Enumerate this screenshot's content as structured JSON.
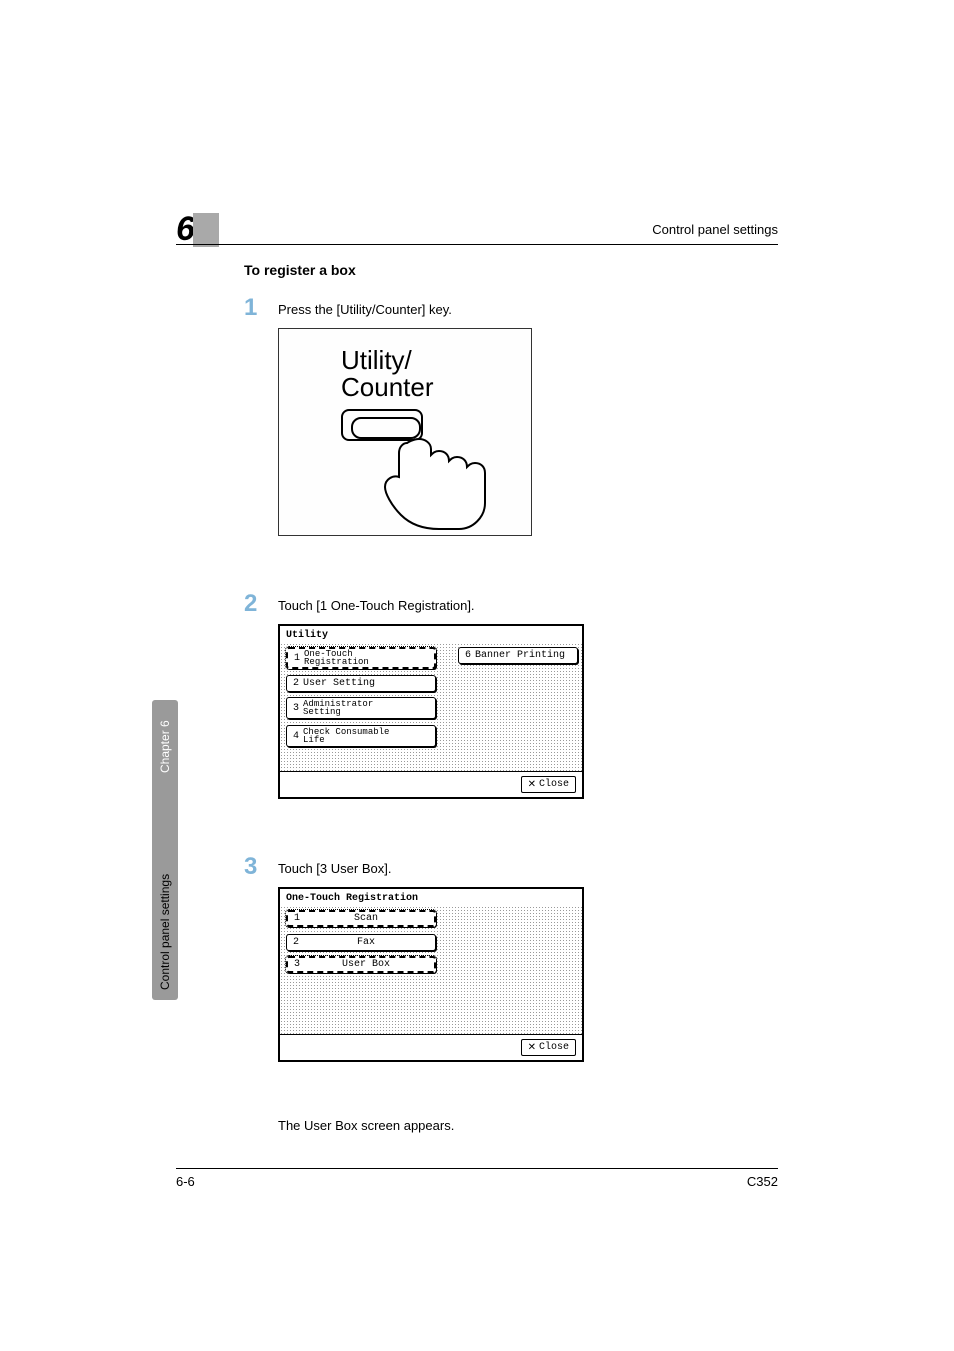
{
  "header": {
    "chapter_number": "6",
    "right_label": "Control panel settings"
  },
  "side_tab": {
    "section": "Control panel settings",
    "chapter": "Chapter 6"
  },
  "section": {
    "heading": "To register a box"
  },
  "steps": {
    "s1": {
      "num": "1",
      "text": "Press the [Utility/Counter] key."
    },
    "s2": {
      "num": "2",
      "text": "Touch [1 One-Touch Registration]."
    },
    "s3": {
      "num": "3",
      "text": "Touch [3 User Box]."
    }
  },
  "fig1": {
    "label_line1": "Utility/",
    "label_line2": "Counter"
  },
  "screen2": {
    "title": "Utility",
    "items": {
      "i1": {
        "idx": "1",
        "label": "One-Touch\nRegistration"
      },
      "i2": {
        "idx": "2",
        "label": "User Setting"
      },
      "i3": {
        "idx": "3",
        "label": "Administrator\nSetting"
      },
      "i4": {
        "idx": "4",
        "label": "Check Consumable\nLife"
      },
      "i6": {
        "idx": "6",
        "label": "Banner Printing"
      }
    },
    "close": "Close"
  },
  "screen3": {
    "title": "One-Touch Registration",
    "items": {
      "i1": {
        "idx": "1",
        "label": "Scan"
      },
      "i2": {
        "idx": "2",
        "label": "Fax"
      },
      "i3": {
        "idx": "3",
        "label": "User Box"
      }
    },
    "close": "Close"
  },
  "after_screen3": "The User Box screen appears.",
  "footer": {
    "left": "6-6",
    "right": "C352"
  }
}
